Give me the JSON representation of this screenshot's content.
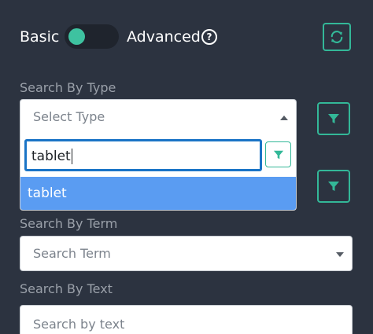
{
  "mode_toggle": {
    "left_label": "Basic",
    "right_label": "Advanced",
    "help_glyph": "?",
    "accent_color": "#3ec2a0"
  },
  "refresh_button": {
    "icon": "refresh-icon"
  },
  "search_by_type": {
    "label": "Search By Type",
    "placeholder": "Select Type",
    "dropdown": {
      "search_value": "tablet",
      "filter_icon": "filter-icon",
      "options": [
        "tablet"
      ],
      "highlight_color": "#5a9cf2"
    }
  },
  "search_by_term": {
    "label": "Search By Term",
    "placeholder": "Search Term"
  },
  "search_by_text": {
    "label": "Search By Text",
    "placeholder": "Search by text"
  }
}
